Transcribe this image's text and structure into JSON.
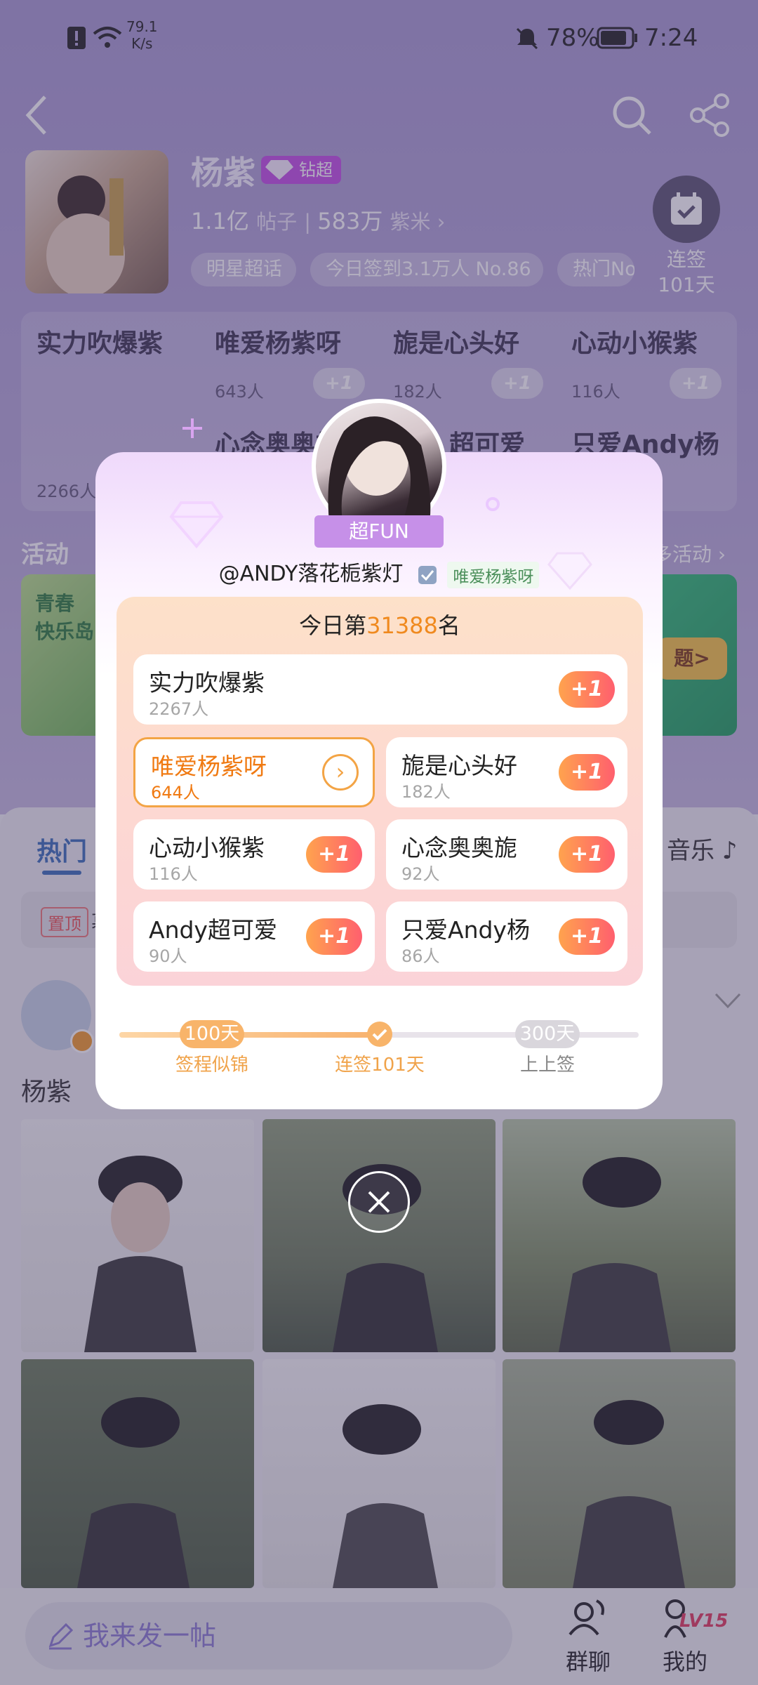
{
  "status_bar": {
    "speed": "79.1\nK/s",
    "battery": "78%",
    "time": "7:24"
  },
  "topic": {
    "title": "杨紫",
    "badge": "钻超",
    "posts_count": "1.1亿",
    "posts_label": "帖子",
    "fans_count": "583万",
    "fans_label": "紫米",
    "chips": [
      "明星超话",
      "今日签到3.1万人 No.86",
      "热门No"
    ],
    "checkin_label": "连签\n101天"
  },
  "background_ranks": [
    {
      "name": "实力吹爆紫",
      "count": "2266人"
    },
    {
      "name": "唯爱杨紫呀",
      "count": "643人"
    },
    {
      "name": "旎是心头好",
      "count": "182人"
    },
    {
      "name": "心动小猴紫",
      "count": "116人"
    },
    {
      "name": "心念奥奥旎",
      "count": ""
    },
    {
      "name": "超可爱",
      "count": ""
    },
    {
      "name": "只爱Andy杨",
      "count": ""
    }
  ],
  "activity": {
    "title": "活动",
    "more": "多活动 ›",
    "card1_text": "青春\n快乐岛",
    "card2_text": "题>"
  },
  "feed": {
    "tab_hot": "热门",
    "tab_music": "音乐",
    "pinned_tag": "置顶",
    "pinned_text": "暮",
    "author_name": "杨紫"
  },
  "bottom": {
    "compose_placeholder": "我来发一帖",
    "group_chat": "群聊",
    "mine": "我的",
    "level": "LV15"
  },
  "modal": {
    "ribbon": "超FUN",
    "handle": "@ANDY落花栀紫灯",
    "group_tag": "唯爱杨紫呀",
    "rank_prefix": "今日第",
    "rank_number": "31388",
    "rank_suffix": "名",
    "plus_label": "+1",
    "groups": [
      {
        "name": "实力吹爆紫",
        "count": "2267人"
      },
      {
        "name": "唯爱杨紫呀",
        "count": "644人"
      },
      {
        "name": "旎是心头好",
        "count": "182人"
      },
      {
        "name": "心动小猴紫",
        "count": "116人"
      },
      {
        "name": "心念奥奥旎",
        "count": "92人"
      },
      {
        "name": "Andy超可爱",
        "count": "90人"
      },
      {
        "name": "只爱Andy杨",
        "count": "86人"
      }
    ],
    "progress": {
      "fraction": 0.5,
      "m1_value": "100天",
      "m1_label": "签程似锦",
      "m2_label": "连签101天",
      "m3_value": "300天",
      "m3_label": "上上签"
    }
  },
  "colors": {
    "accent_orange": "#f08a1f",
    "plus_gradient_start": "#ffa34e",
    "plus_gradient_end": "#ff5f6e",
    "header_purple": "#a99bd3"
  }
}
